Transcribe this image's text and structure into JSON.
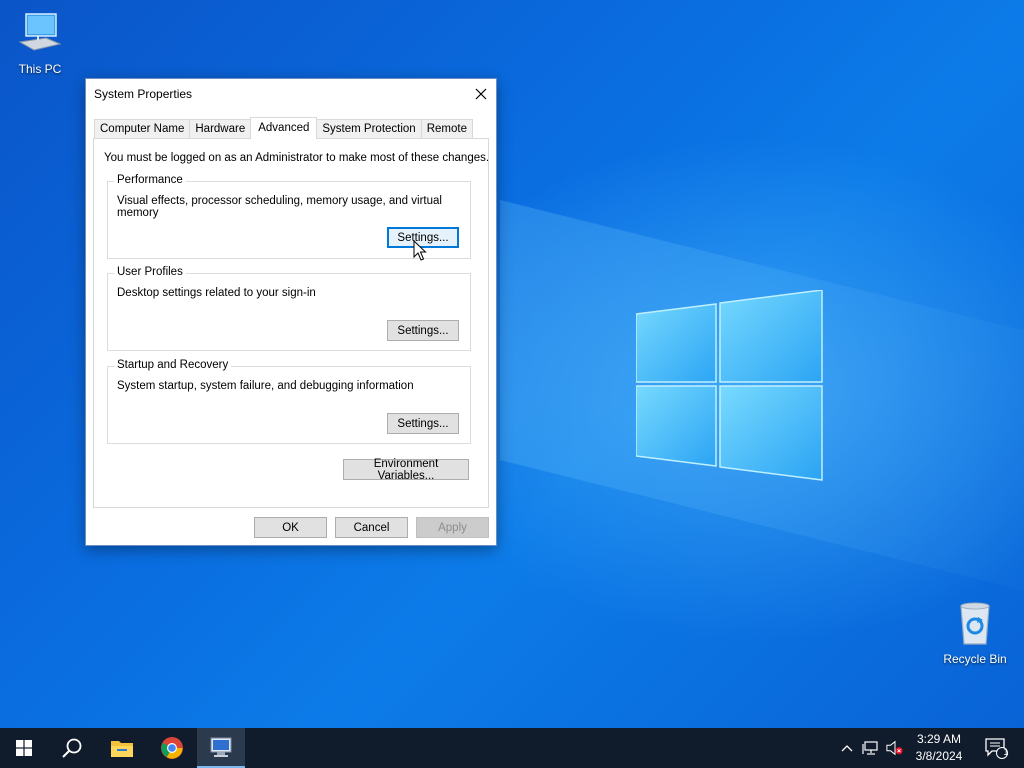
{
  "desktop": {
    "icons": [
      {
        "label": "This PC",
        "icon": "this-pc-icon"
      },
      {
        "label": "Recycle Bin",
        "icon": "recycle-bin-icon"
      }
    ]
  },
  "dialog": {
    "title": "System Properties",
    "tabs": [
      "Computer Name",
      "Hardware",
      "Advanced",
      "System Protection",
      "Remote"
    ],
    "active_tab": "Advanced",
    "note": "You must be logged on as an Administrator to make most of these changes.",
    "groups": [
      {
        "legend": "Performance",
        "description": "Visual effects, processor scheduling, memory usage, and virtual memory",
        "button": "Settings..."
      },
      {
        "legend": "User Profiles",
        "description": "Desktop settings related to your sign-in",
        "button": "Settings..."
      },
      {
        "legend": "Startup and Recovery",
        "description": "System startup, system failure, and debugging information",
        "button": "Settings..."
      }
    ],
    "env_button": "Environment Variables...",
    "ok_label": "OK",
    "cancel_label": "Cancel",
    "apply_label": "Apply"
  },
  "taskbar": {
    "time": "3:29 AM",
    "date": "3/8/2024",
    "notification_count": "1",
    "colors": {
      "background": "#101b2b",
      "accent": "#0078d7"
    }
  }
}
